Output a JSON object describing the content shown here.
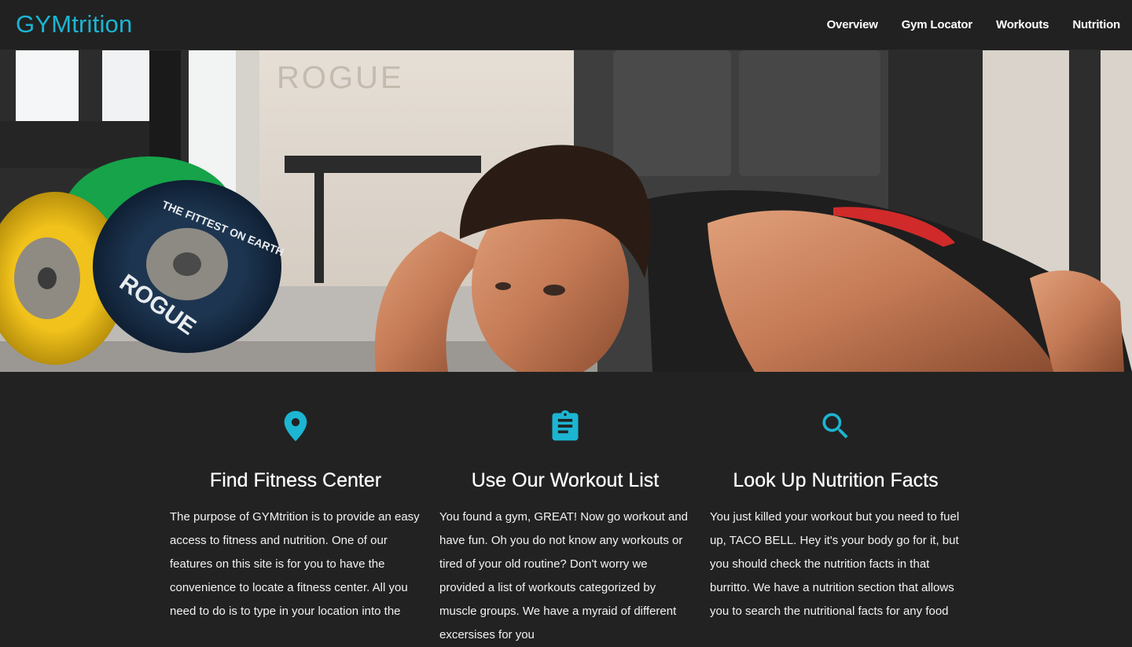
{
  "brand": {
    "name": "GYMtrition",
    "color": "#1cb5d2"
  },
  "nav": {
    "items": [
      {
        "label": "Overview"
      },
      {
        "label": "Gym Locator"
      },
      {
        "label": "Workouts"
      },
      {
        "label": "Nutrition"
      }
    ]
  },
  "hero": {
    "plate_text_a": "ROGUE",
    "plate_text_b": "THE FITTEST ON EARTH",
    "wall_text": "ROGUE"
  },
  "features": [
    {
      "icon": "location-pin-icon",
      "title": "Find Fitness Center",
      "text": "The purpose of GYMtrition is to provide an easy access to fitness and nutrition. One of our features on this site is for you to have the convenience to locate a fitness center. All you need to do is to type in your location into the"
    },
    {
      "icon": "clipboard-list-icon",
      "title": "Use Our Workout List",
      "text": "You found a gym, GREAT! Now go workout and have fun. Oh you do not know any workouts or tired of your old routine? Don't worry we provided a list of workouts categorized by muscle groups. We have a myraid of different excersises for you"
    },
    {
      "icon": "search-icon",
      "title": "Look Up Nutrition Facts",
      "text": "You just killed your workout but you need to fuel up, TACO BELL. Hey it's your body go for it, but you should check the nutrition facts in that burritto. We have a nutrition section that allows you to search the nutritional facts for any food"
    }
  ],
  "colors": {
    "accent": "#1cb5d2",
    "background": "#222222",
    "navbar": "#212121"
  }
}
